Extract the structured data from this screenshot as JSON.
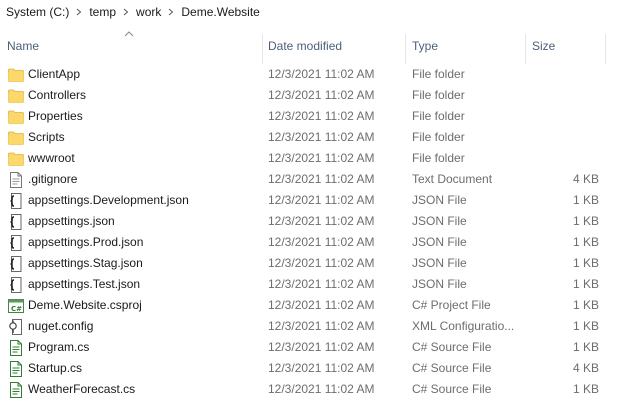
{
  "breadcrumb": [
    "System (C:)",
    "temp",
    "work",
    "Deme.Website"
  ],
  "columns": {
    "name": "Name",
    "date_modified": "Date modified",
    "type": "Type",
    "size": "Size"
  },
  "sort": {
    "column": "name",
    "direction": "ascending"
  },
  "files": [
    {
      "name": "ClientApp",
      "date": "12/3/2021 11:02 AM",
      "type": "File folder",
      "size": "",
      "icon": "folder-icon"
    },
    {
      "name": "Controllers",
      "date": "12/3/2021 11:02 AM",
      "type": "File folder",
      "size": "",
      "icon": "folder-icon"
    },
    {
      "name": "Properties",
      "date": "12/3/2021 11:02 AM",
      "type": "File folder",
      "size": "",
      "icon": "folder-icon"
    },
    {
      "name": "Scripts",
      "date": "12/3/2021 11:02 AM",
      "type": "File folder",
      "size": "",
      "icon": "folder-icon"
    },
    {
      "name": "wwwroot",
      "date": "12/3/2021 11:02 AM",
      "type": "File folder",
      "size": "",
      "icon": "folder-icon"
    },
    {
      "name": ".gitignore",
      "date": "12/3/2021 11:02 AM",
      "type": "Text Document",
      "size": "4 KB",
      "icon": "text-file-icon"
    },
    {
      "name": "appsettings.Development.json",
      "date": "12/3/2021 11:02 AM",
      "type": "JSON File",
      "size": "1 KB",
      "icon": "json-file-icon"
    },
    {
      "name": "appsettings.json",
      "date": "12/3/2021 11:02 AM",
      "type": "JSON File",
      "size": "1 KB",
      "icon": "json-file-icon"
    },
    {
      "name": "appsettings.Prod.json",
      "date": "12/3/2021 11:02 AM",
      "type": "JSON File",
      "size": "1 KB",
      "icon": "json-file-icon"
    },
    {
      "name": "appsettings.Stag.json",
      "date": "12/3/2021 11:02 AM",
      "type": "JSON File",
      "size": "1 KB",
      "icon": "json-file-icon"
    },
    {
      "name": "appsettings.Test.json",
      "date": "12/3/2021 11:02 AM",
      "type": "JSON File",
      "size": "1 KB",
      "icon": "json-file-icon"
    },
    {
      "name": "Deme.Website.csproj",
      "date": "12/3/2021 11:02 AM",
      "type": "C# Project File",
      "size": "1 KB",
      "icon": "csproj-file-icon"
    },
    {
      "name": "nuget.config",
      "date": "12/3/2021 11:02 AM",
      "type": "XML Configuratio...",
      "size": "1 KB",
      "icon": "config-file-icon"
    },
    {
      "name": "Program.cs",
      "date": "12/3/2021 11:02 AM",
      "type": "C# Source File",
      "size": "1 KB",
      "icon": "cs-file-icon"
    },
    {
      "name": "Startup.cs",
      "date": "12/3/2021 11:02 AM",
      "type": "C# Source File",
      "size": "4 KB",
      "icon": "cs-file-icon"
    },
    {
      "name": "WeatherForecast.cs",
      "date": "12/3/2021 11:02 AM",
      "type": "C# Source File",
      "size": "1 KB",
      "icon": "cs-file-icon"
    }
  ],
  "colors": {
    "folder": "#f8d775",
    "folder_dark": "#e0b03c",
    "header_text": "#4c607a",
    "detail_text": "#6d6d6d",
    "cs_green": "#2e7d32"
  }
}
